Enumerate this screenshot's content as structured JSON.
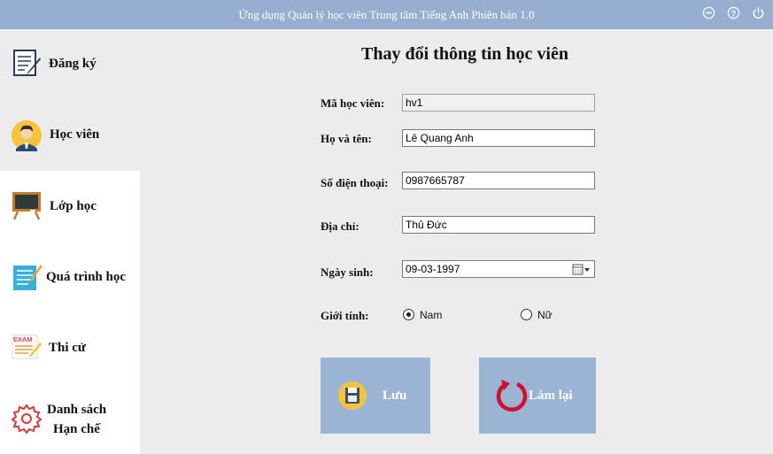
{
  "window": {
    "title": "Ứng dụng Quản lý học viên Trung tâm Tiếng Anh Phiên bản 1.0",
    "controls": [
      "minimize-icon",
      "help-icon",
      "power-icon"
    ]
  },
  "sidebar": {
    "items": [
      {
        "label": "Đăng ký",
        "icon": "register-document-icon"
      },
      {
        "label": "Học viên",
        "icon": "student-icon"
      },
      {
        "label": "Lớp học",
        "icon": "blackboard-icon"
      },
      {
        "label": "Quá trình học",
        "icon": "notepad-pencil-icon"
      },
      {
        "label": "Thi cử",
        "icon": "exam-icon"
      },
      {
        "label_line1": "Danh sách",
        "label_line2": "Hạn chế",
        "icon": "gear-icon"
      }
    ]
  },
  "form": {
    "title": "Thay đổi thông tin học viên",
    "student_id_label": "Mã học viên:",
    "student_id_value": "hv1",
    "fullname_label": "Họ và tên:",
    "fullname_value": "Lê Quang Anh",
    "phone_label": "Số điện thoại:",
    "phone_value": "0987665787",
    "address_label": "Địa chỉ:",
    "address_value": "Thủ Đức",
    "birthdate_label": "Ngày sinh:",
    "birthdate_value": "09-03-1997",
    "gender_label": "Giới tính:",
    "gender_options": [
      "Nam",
      "Nữ"
    ],
    "gender_selected": "Nam"
  },
  "actions": {
    "save_label": "Lưu",
    "reset_label": "Làm lại"
  },
  "colors": {
    "titlebar": "#96afd0",
    "button": "#9cb4d3",
    "background": "#ececec"
  }
}
